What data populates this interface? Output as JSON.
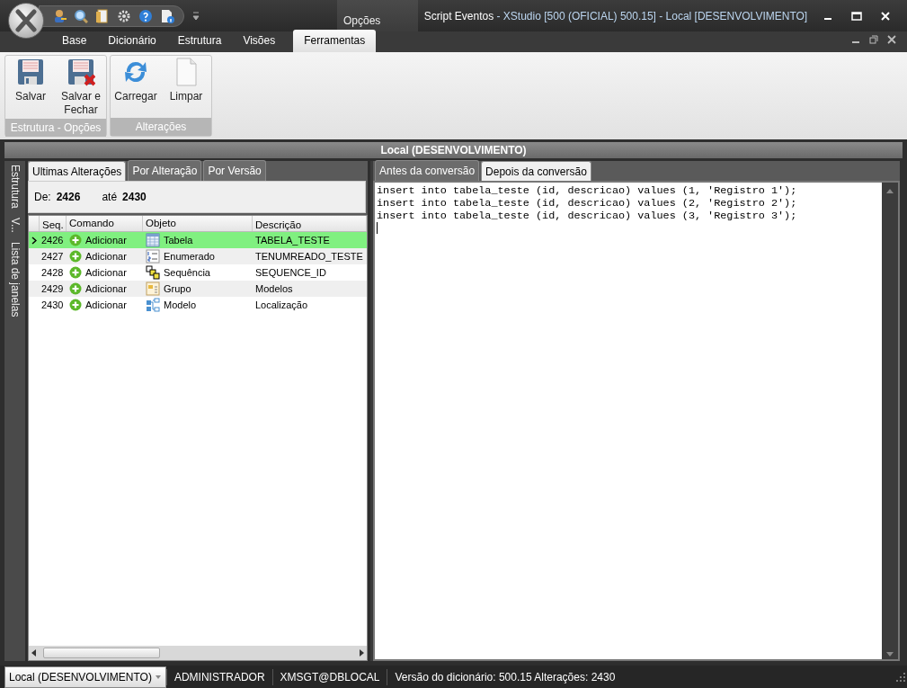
{
  "window": {
    "document": "Script Eventos",
    "app": "- XStudio [500 (OFICIAL) 500.15] - Local [DESENVOLVIMENTO]"
  },
  "contextual_group": "Opções",
  "ribbon_tabs": [
    {
      "label": "Base",
      "selected": false
    },
    {
      "label": "Dicionário",
      "selected": false
    },
    {
      "label": "Estrutura",
      "selected": false
    },
    {
      "label": "Visões",
      "selected": false
    },
    {
      "label": "Ferramentas",
      "selected": true
    }
  ],
  "ribbon_groups": [
    {
      "label": "Estrutura - Opções",
      "buttons": [
        {
          "label": "Salvar",
          "kind": "save"
        },
        {
          "label": "Salvar e Fechar",
          "kind": "save-close"
        }
      ]
    },
    {
      "label": "Alterações",
      "buttons": [
        {
          "label": "Carregar",
          "kind": "reload"
        },
        {
          "label": "Limpar",
          "kind": "blank"
        }
      ]
    }
  ],
  "panel_title": "Local (DESENVOLVIMENTO)",
  "side_tabs": [
    "Estrutura",
    "V...",
    "Lista de janelas"
  ],
  "left_tabs": [
    {
      "label": "Ultimas Alterações",
      "selected": true
    },
    {
      "label": "Por Alteração",
      "selected": false
    },
    {
      "label": "Por Versão",
      "selected": false
    }
  ],
  "range": {
    "from_label": "De:",
    "from": "2426",
    "to_label": "até",
    "to": "2430"
  },
  "table": {
    "columns": [
      "Seq.",
      "Comando",
      "Objeto",
      "Descrição"
    ],
    "rows": [
      {
        "seq": "2426",
        "command": "Adicionar",
        "object": "Tabela",
        "kind": "table",
        "description": "TABELA_TESTE",
        "selected": true
      },
      {
        "seq": "2427",
        "command": "Adicionar",
        "object": "Enumerado",
        "kind": "enum",
        "description": "TENUMREADO_TESTE",
        "selected": false
      },
      {
        "seq": "2428",
        "command": "Adicionar",
        "object": "Sequência",
        "kind": "sequence",
        "description": "SEQUENCE_ID",
        "selected": false
      },
      {
        "seq": "2429",
        "command": "Adicionar",
        "object": "Grupo",
        "kind": "group",
        "description": "Modelos",
        "selected": false
      },
      {
        "seq": "2430",
        "command": "Adicionar",
        "object": "Modelo",
        "kind": "model",
        "description": "Localização",
        "selected": false
      }
    ]
  },
  "right_tabs": [
    {
      "label": "Antes da conversão",
      "selected": false
    },
    {
      "label": "Depois da conversão",
      "selected": true
    }
  ],
  "editor_lines": [
    "insert into tabela_teste (id, descricao) values (1, 'Registro 1');",
    "insert into tabela_teste (id, descricao) values (2, 'Registro 2');",
    "insert into tabela_teste (id, descricao) values (3, 'Registro 3');"
  ],
  "status_bar": {
    "connection": "Local (DESENVOLVIMENTO)",
    "user": "ADMINISTRADOR",
    "database": "XMSGT@DBLOCAL",
    "info": "Versão do dicionário: 500.15 Alterações: 2430"
  }
}
